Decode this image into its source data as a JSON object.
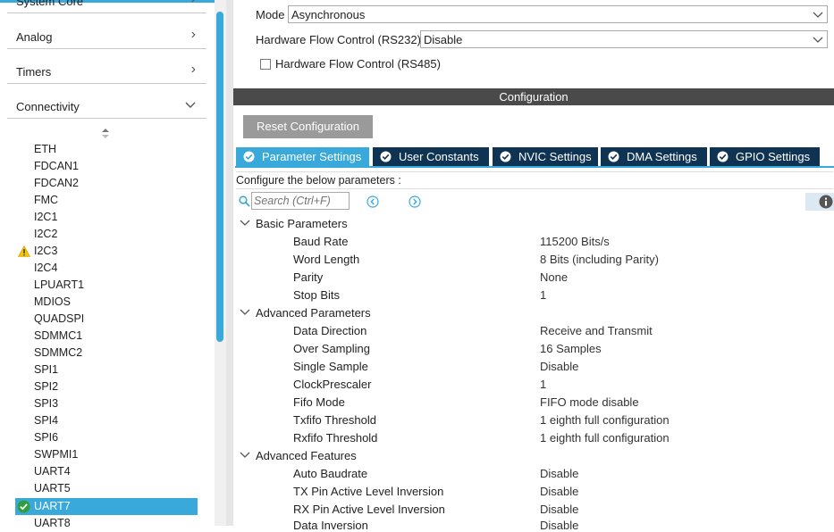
{
  "sidebar": {
    "categories": [
      {
        "label": "System Core",
        "expanded": false
      },
      {
        "label": "Analog",
        "expanded": false
      },
      {
        "label": "Timers",
        "expanded": false
      },
      {
        "label": "Connectivity",
        "expanded": true
      }
    ],
    "peripherals": [
      {
        "label": "ETH"
      },
      {
        "label": "FDCAN1"
      },
      {
        "label": "FDCAN2"
      },
      {
        "label": "FMC"
      },
      {
        "label": "I2C1"
      },
      {
        "label": "I2C2"
      },
      {
        "label": "I2C3",
        "status": "warning"
      },
      {
        "label": "I2C4"
      },
      {
        "label": "LPUART1"
      },
      {
        "label": "MDIOS"
      },
      {
        "label": "QUADSPI"
      },
      {
        "label": "SDMMC1"
      },
      {
        "label": "SDMMC2"
      },
      {
        "label": "SPI1"
      },
      {
        "label": "SPI2"
      },
      {
        "label": "SPI3"
      },
      {
        "label": "SPI4"
      },
      {
        "label": "SPI6"
      },
      {
        "label": "SWPMI1"
      },
      {
        "label": "UART4"
      },
      {
        "label": "UART5"
      },
      {
        "label": "UART7",
        "status": "ok",
        "selected": true
      },
      {
        "label": "UART8"
      }
    ]
  },
  "mode_panel": {
    "mode_label": "Mode",
    "mode_value": "Asynchronous",
    "hw_flow_label": "Hardware Flow Control (RS232)",
    "hw_flow_value": "Disable",
    "rs485_label": "Hardware Flow Control (RS485)",
    "rs485_checked": false
  },
  "config": {
    "header": "Configuration",
    "reset_button": "Reset Configuration",
    "tabs": [
      {
        "label": "Parameter Settings",
        "active": true
      },
      {
        "label": "User Constants",
        "active": false
      },
      {
        "label": "NVIC Settings",
        "active": false
      },
      {
        "label": "DMA Settings",
        "active": false
      },
      {
        "label": "GPIO Settings",
        "active": false
      }
    ],
    "caption": "Configure the below parameters :",
    "search_placeholder": "Search (Ctrl+F)",
    "groups": [
      {
        "label": "Basic Parameters",
        "params": [
          {
            "name": "Baud Rate",
            "value": "115200 Bits/s"
          },
          {
            "name": "Word Length",
            "value": "8 Bits (including Parity)"
          },
          {
            "name": "Parity",
            "value": "None"
          },
          {
            "name": "Stop Bits",
            "value": "1"
          }
        ]
      },
      {
        "label": "Advanced Parameters",
        "params": [
          {
            "name": "Data Direction",
            "value": "Receive and Transmit"
          },
          {
            "name": "Over Sampling",
            "value": "16 Samples"
          },
          {
            "name": "Single Sample",
            "value": "Disable"
          },
          {
            "name": "ClockPrescaler",
            "value": "1"
          },
          {
            "name": "Fifo Mode",
            "value": "FIFO mode disable"
          },
          {
            "name": "Txfifo Threshold",
            "value": "1 eighth full configuration"
          },
          {
            "name": "Rxfifo Threshold",
            "value": "1 eighth full configuration"
          }
        ]
      },
      {
        "label": "Advanced Features",
        "params": [
          {
            "name": "Auto Baudrate",
            "value": "Disable"
          },
          {
            "name": "TX Pin Active Level Inversion",
            "value": "Disable"
          },
          {
            "name": "RX Pin Active Level Inversion",
            "value": "Disable"
          },
          {
            "name": "Data Inversion",
            "value": "Disable"
          }
        ]
      }
    ]
  },
  "colors": {
    "accent": "#39a9dc",
    "tab_dark": "#0f3353",
    "header_dark": "#4a4a4a",
    "button_gray": "#9a9a9a"
  }
}
